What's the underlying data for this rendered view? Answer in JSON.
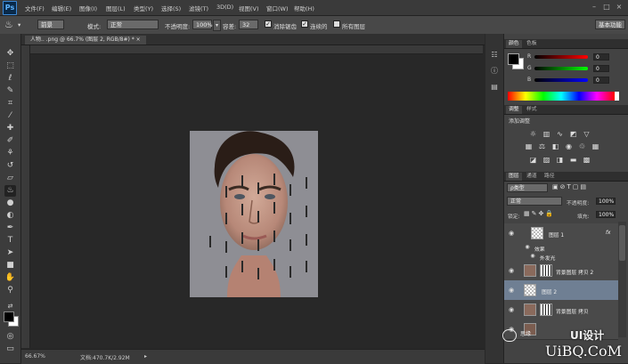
{
  "menubar": {
    "logo": "Ps",
    "items": [
      "文件(F)",
      "编辑(E)",
      "图像(I)",
      "图层(L)",
      "类型(Y)",
      "选择(S)",
      "滤镜(T)",
      "3D(D)",
      "视图(V)",
      "窗口(W)",
      "帮助(H)"
    ],
    "win_min": "–",
    "win_max": "□",
    "win_close": "×"
  },
  "options": {
    "tool_preset": "▾",
    "fill_source": "前景",
    "mode_label": "模式:",
    "mode_value": "正常",
    "opacity_label": "不透明度:",
    "opacity_value": "100%",
    "tolerance_label": "容差:",
    "tolerance_value": "32",
    "antialias_label": "消除锯齿",
    "contiguous_label": "连续的",
    "all_layers_label": "所有图层",
    "workspace": "基本功能"
  },
  "document": {
    "tab_label": "人物.. .png @ 66.7% (图层 2, RGB/8#) *   ×"
  },
  "status": {
    "zoom": "66.67%",
    "doc_size": "文档:470.7K/2.92M",
    "arrow": "▸"
  },
  "color_panel": {
    "tabs": [
      "颜色",
      "色板"
    ],
    "r_label": "R",
    "g_label": "G",
    "b_label": "B",
    "r_value": "0",
    "g_value": "0",
    "b_value": "0"
  },
  "adjust_panel": {
    "tabs": [
      "调整",
      "样式"
    ],
    "title": "添加调整"
  },
  "layers_panel": {
    "tabs": [
      "图层",
      "通道",
      "路径"
    ],
    "kind_filter": "ρ类型",
    "blend_mode": "正常",
    "opacity_label": "不透明度:",
    "opacity_value": "100%",
    "lock_label": "锁定:",
    "fill_label": "填充:",
    "fill_value": "100%",
    "layers": [
      {
        "name": "图层 1",
        "fx": "fx"
      },
      {
        "name": "效果"
      },
      {
        "name": "外发光"
      },
      {
        "name": "背景图层 拷贝 2"
      },
      {
        "name": "图层 2"
      },
      {
        "name": "背景图层 拷贝"
      }
    ]
  },
  "watermark": {
    "text_cn": "UI设计",
    "text_en": "UiBQ.CoM",
    "small": "思缘"
  },
  "colors": {
    "accent": "#6f7f93",
    "brand": "#3d8ad8"
  }
}
